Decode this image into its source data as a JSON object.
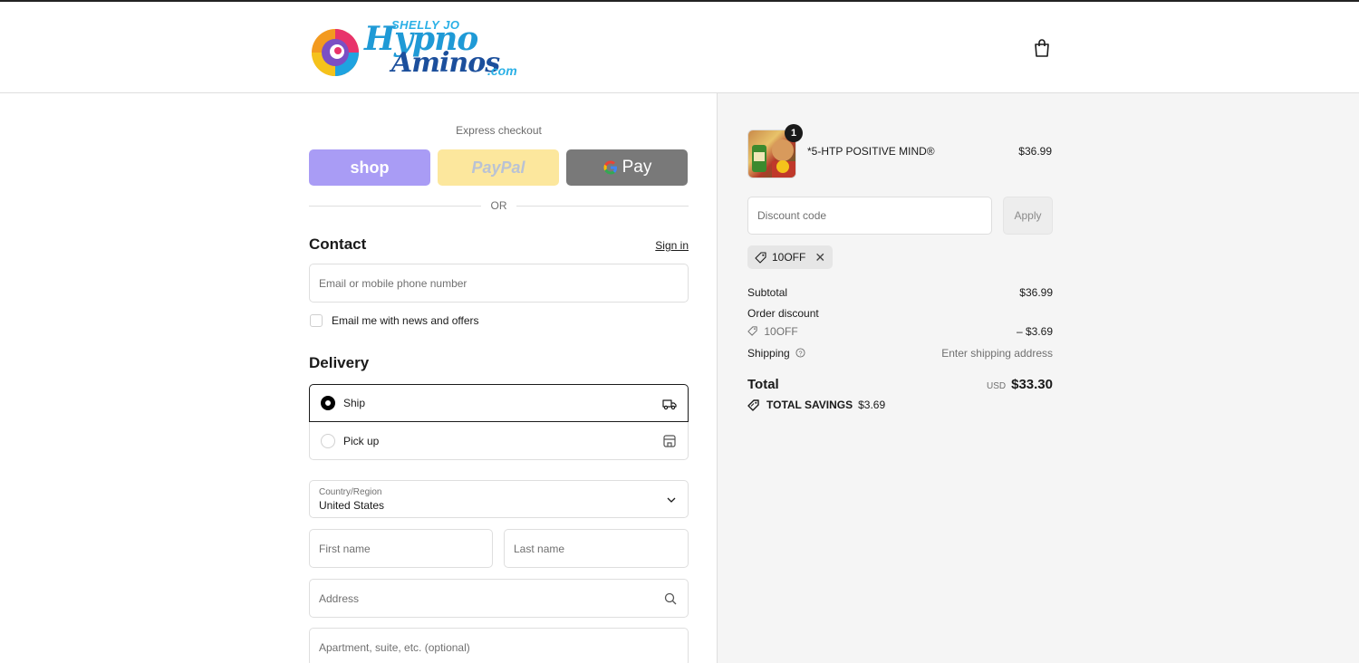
{
  "header": {
    "logo_top": "SHELLY JO",
    "logo_line1": "Hypno",
    "logo_line2": "Aminos",
    "logo_suffix": ".com",
    "cart_icon": "shopping-bag-icon"
  },
  "express": {
    "label": "Express checkout",
    "buttons": [
      "shop",
      "PayPal",
      "Pay"
    ],
    "or": "OR"
  },
  "contact": {
    "title": "Contact",
    "sign_in": "Sign in",
    "email_placeholder": "Email or mobile phone number",
    "news_label": "Email me with news and offers"
  },
  "delivery": {
    "title": "Delivery",
    "options": [
      {
        "label": "Ship",
        "selected": true,
        "icon": "truck-icon"
      },
      {
        "label": "Pick up",
        "selected": false,
        "icon": "store-icon"
      }
    ],
    "country_label": "Country/Region",
    "country_value": "United States",
    "first_name": "First name",
    "last_name": "Last name",
    "address": "Address",
    "apartment": "Apartment, suite, etc. (optional)"
  },
  "summary": {
    "item": {
      "qty": "1",
      "name": "*5-HTP POSITIVE MIND®",
      "price": "$36.99"
    },
    "discount_placeholder": "Discount code",
    "apply": "Apply",
    "applied_code": "10OFF",
    "subtotal_label": "Subtotal",
    "subtotal": "$36.99",
    "order_discount_label": "Order discount",
    "order_discount_code": "10OFF",
    "order_discount_value": "– $3.69",
    "shipping_label": "Shipping",
    "shipping_value": "Enter shipping address",
    "total_label": "Total",
    "currency": "USD",
    "total": "$33.30",
    "savings_label": "TOTAL SAVINGS",
    "savings_value": "$3.69"
  },
  "colors": {
    "shop": "#a99cf5",
    "paypal": "#fce79d",
    "gpay": "#797979",
    "summary_bg": "#f5f5f5"
  }
}
